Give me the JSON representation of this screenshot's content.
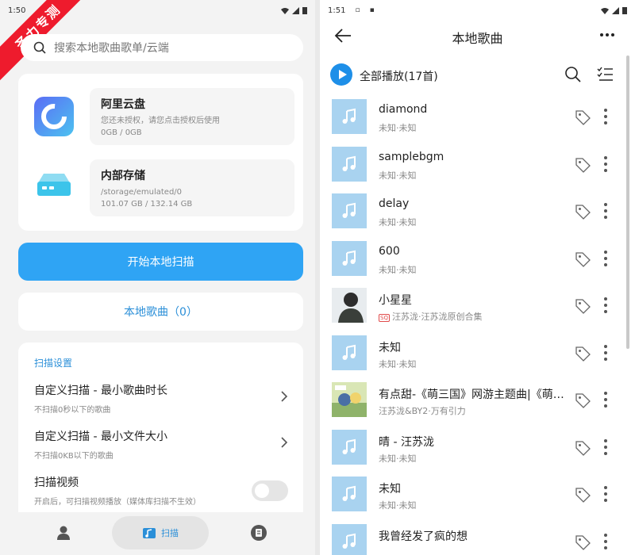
{
  "left_status": {
    "time": "1:50"
  },
  "watermark": "圣力专测",
  "search": {
    "placeholder": "搜索本地歌曲歌单/云端"
  },
  "storage": [
    {
      "title": "阿里云盘",
      "line1": "您还未授权，请您点击授权后使用",
      "line2": "0GB / 0GB",
      "icon": "aliyun-drive-icon"
    },
    {
      "title": "内部存储",
      "line1": "/storage/emulated/0",
      "line2": "101.07 GB / 132.14 GB",
      "icon": "internal-storage-icon"
    }
  ],
  "scan_button": "开始本地扫描",
  "local_songs_button": "本地歌曲（0）",
  "settings": {
    "header": "扫描设置",
    "rows": [
      {
        "title": "自定义扫描 - 最小歌曲时长",
        "sub": "不扫描0秒以下的歌曲"
      },
      {
        "title": "自定义扫描 - 最小文件大小",
        "sub": "不扫描0KB以下的歌曲"
      },
      {
        "title": "扫描视频",
        "sub": "开启后，可扫描视频播放（媒体库扫描不生效）",
        "toggle": false
      }
    ]
  },
  "bottom_nav": {
    "scan_label": "扫描",
    "items": [
      "profile-icon",
      "scan-icon",
      "playlist-icon"
    ]
  },
  "right_status": {
    "time": "1:51"
  },
  "page": {
    "title": "本地歌曲",
    "play_all": "全部播放(17首)"
  },
  "songs": [
    {
      "title": "diamond",
      "artist": "未知·未知",
      "cover": "music-note"
    },
    {
      "title": "samplebgm",
      "artist": "未知·未知",
      "cover": "music-note"
    },
    {
      "title": "delay",
      "artist": "未知·未知",
      "cover": "music-note"
    },
    {
      "title": "600",
      "artist": "未知·未知",
      "cover": "music-note"
    },
    {
      "title": "小星星",
      "artist": "汪苏泷·汪苏泷原创合集",
      "badge": "SQ",
      "cover": "photo-person"
    },
    {
      "title": "未知",
      "artist": "未知·未知",
      "cover": "music-note"
    },
    {
      "title": "有点甜-《萌三国》网游主题曲|《萌三国》",
      "artist": "汪苏泷&BY2·万有引力",
      "cover": "photo-album"
    },
    {
      "title": "晴 - 汪苏泷",
      "artist": "未知·未知",
      "cover": "music-note"
    },
    {
      "title": "未知",
      "artist": "未知·未知",
      "cover": "music-note"
    },
    {
      "title": "我曾经发了疯的想",
      "artist": "",
      "cover": "music-note"
    }
  ],
  "colors": {
    "accent": "#2fa4f4",
    "link": "#2b8fd8",
    "cover": "#a9d3f0",
    "play": "#1e8fe8"
  }
}
